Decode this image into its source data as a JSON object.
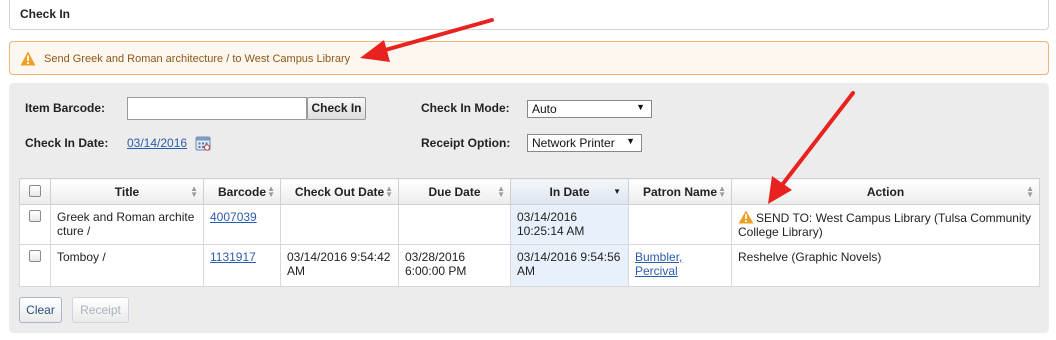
{
  "header": {
    "title": "Check In"
  },
  "alert": {
    "message": "Send Greek and Roman architecture / to West Campus Library"
  },
  "form": {
    "item_barcode_label": "Item Barcode:",
    "item_barcode_value": "",
    "check_in_button": "Check In",
    "check_in_date_label": "Check In Date:",
    "check_in_date_value": "03/14/2016",
    "check_in_mode_label": "Check In Mode:",
    "check_in_mode_value": "Auto",
    "receipt_option_label": "Receipt Option:",
    "receipt_option_value": "Network Printer"
  },
  "table": {
    "columns": [
      "Title",
      "Barcode",
      "Check Out Date",
      "Due Date",
      "In Date",
      "Patron Name",
      "Action"
    ],
    "rows": [
      {
        "title": "Greek and Roman archite cture /",
        "barcode": "4007039",
        "check_out_date": "",
        "due_date": "",
        "in_date": "03/14/2016 10:25:14 AM",
        "patron_name": "",
        "action": "SEND TO: West Campus Library (Tulsa Community College Library)"
      },
      {
        "title": "Tomboy /",
        "barcode": "1131917",
        "check_out_date": "03/14/2016 9:54:42 AM",
        "due_date": "03/28/2016 6:00:00 PM",
        "in_date": "03/14/2016 9:54:56 AM",
        "patron_name": "Bumbler, Percival",
        "action": "Reshelve (Graphic Novels)"
      }
    ]
  },
  "buttons": {
    "clear": "Clear",
    "receipt": "Receipt"
  },
  "colors": {
    "alert_border": "#f0b37e",
    "alert_text": "#8a5a1a",
    "link": "#2a5db0",
    "annotation_arrow": "#e8231f",
    "warning_icon": "#f0a020"
  }
}
